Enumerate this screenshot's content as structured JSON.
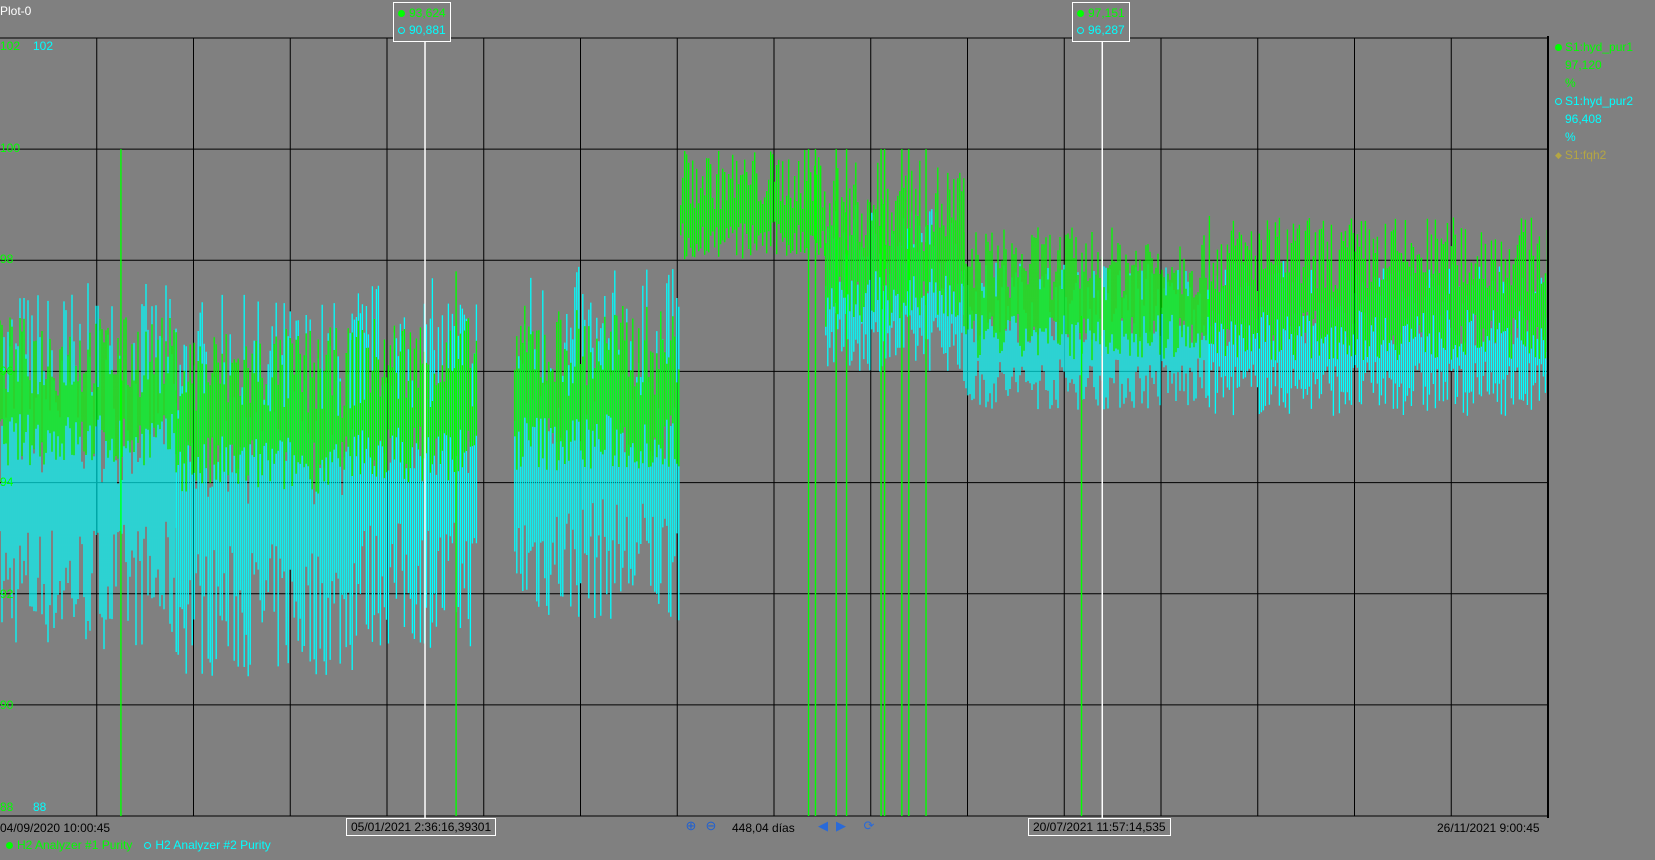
{
  "window": {
    "title": "Plot-0"
  },
  "colors": {
    "series1": "#00ff00",
    "series2": "#00ffff",
    "series3": "#b5a642",
    "background": "#808080",
    "grid": "#000000",
    "cursor": "#ffffff"
  },
  "y_axis": {
    "left_ticks": [
      "102",
      "100",
      "98",
      "96",
      "94",
      "92",
      "90",
      "88"
    ],
    "top_cyan": "102",
    "bottom_cyan": "88"
  },
  "x_axis": {
    "start": "04/09/2020 10:00:45",
    "end": "26/11/2021 9:00:45",
    "span": "448,04 días"
  },
  "cursors": [
    {
      "time": "05/01/2021 2:36:16,39301",
      "value1": "93,624",
      "value2": "90,881"
    },
    {
      "time": "20/07/2021 11:57:14,535",
      "value1": "97,151",
      "value2": "96,287"
    }
  ],
  "legend_right": [
    {
      "name": "S1:hyd_pur1",
      "value": "97,120",
      "unit": "%"
    },
    {
      "name": "S1:hyd_pur2",
      "value": "96,408",
      "unit": "%"
    },
    {
      "name": "S1:fqh2"
    }
  ],
  "bottom_legend": [
    {
      "label": "H2 Analyzer #1 Purity"
    },
    {
      "label": "H2 Analyzer #2 Purity"
    }
  ],
  "icons": {
    "zoom_in": "zoom-in-icon",
    "zoom_out": "zoom-out-icon",
    "prev": "triangle-left-icon",
    "next": "triangle-right-icon",
    "refresh": "refresh-icon"
  },
  "chart_data": {
    "type": "line",
    "ylim": [
      88,
      102
    ],
    "x_start_date": "2020-09-04",
    "x_end_date": "2021-11-26",
    "grid": true,
    "series": [
      {
        "name": "S1:hyd_pur1",
        "bands": [
          {
            "from": "2020-09-04",
            "to": "2020-10-25",
            "low": 94.3,
            "high": 97.0
          },
          {
            "from": "2020-10-25",
            "to": "2020-12-15",
            "low": 93.8,
            "high": 96.8
          },
          {
            "from": "2020-12-15",
            "to": "2021-01-20",
            "low": 94.0,
            "high": 97.0
          },
          {
            "from": "2021-01-31",
            "to": "2021-03-20",
            "low": 94.2,
            "high": 97.2
          },
          {
            "from": "2021-03-20",
            "to": "2021-05-01",
            "low": 98.0,
            "high": 100.0
          },
          {
            "from": "2021-05-01",
            "to": "2021-06-10",
            "low": 96.8,
            "high": 99.8
          },
          {
            "from": "2021-06-10",
            "to": "2021-08-20",
            "low": 96.2,
            "high": 98.6
          },
          {
            "from": "2021-08-20",
            "to": "2021-11-26",
            "low": 96.2,
            "high": 98.8
          }
        ]
      },
      {
        "name": "S1:hyd_pur2",
        "bands": [
          {
            "from": "2020-09-04",
            "to": "2020-10-25",
            "low": 91.0,
            "high": 97.6
          },
          {
            "from": "2020-10-25",
            "to": "2020-12-15",
            "low": 90.5,
            "high": 97.4
          },
          {
            "from": "2020-12-15",
            "to": "2021-01-20",
            "low": 91.0,
            "high": 97.7
          },
          {
            "from": "2021-01-31",
            "to": "2021-03-20",
            "low": 91.5,
            "high": 97.9
          },
          {
            "from": "2021-05-01",
            "to": "2021-06-10",
            "low": 96.0,
            "high": 99.0
          },
          {
            "from": "2021-06-10",
            "to": "2021-08-20",
            "low": 95.3,
            "high": 98.0
          },
          {
            "from": "2021-08-20",
            "to": "2021-11-26",
            "low": 95.2,
            "high": 98.0
          }
        ]
      }
    ]
  }
}
